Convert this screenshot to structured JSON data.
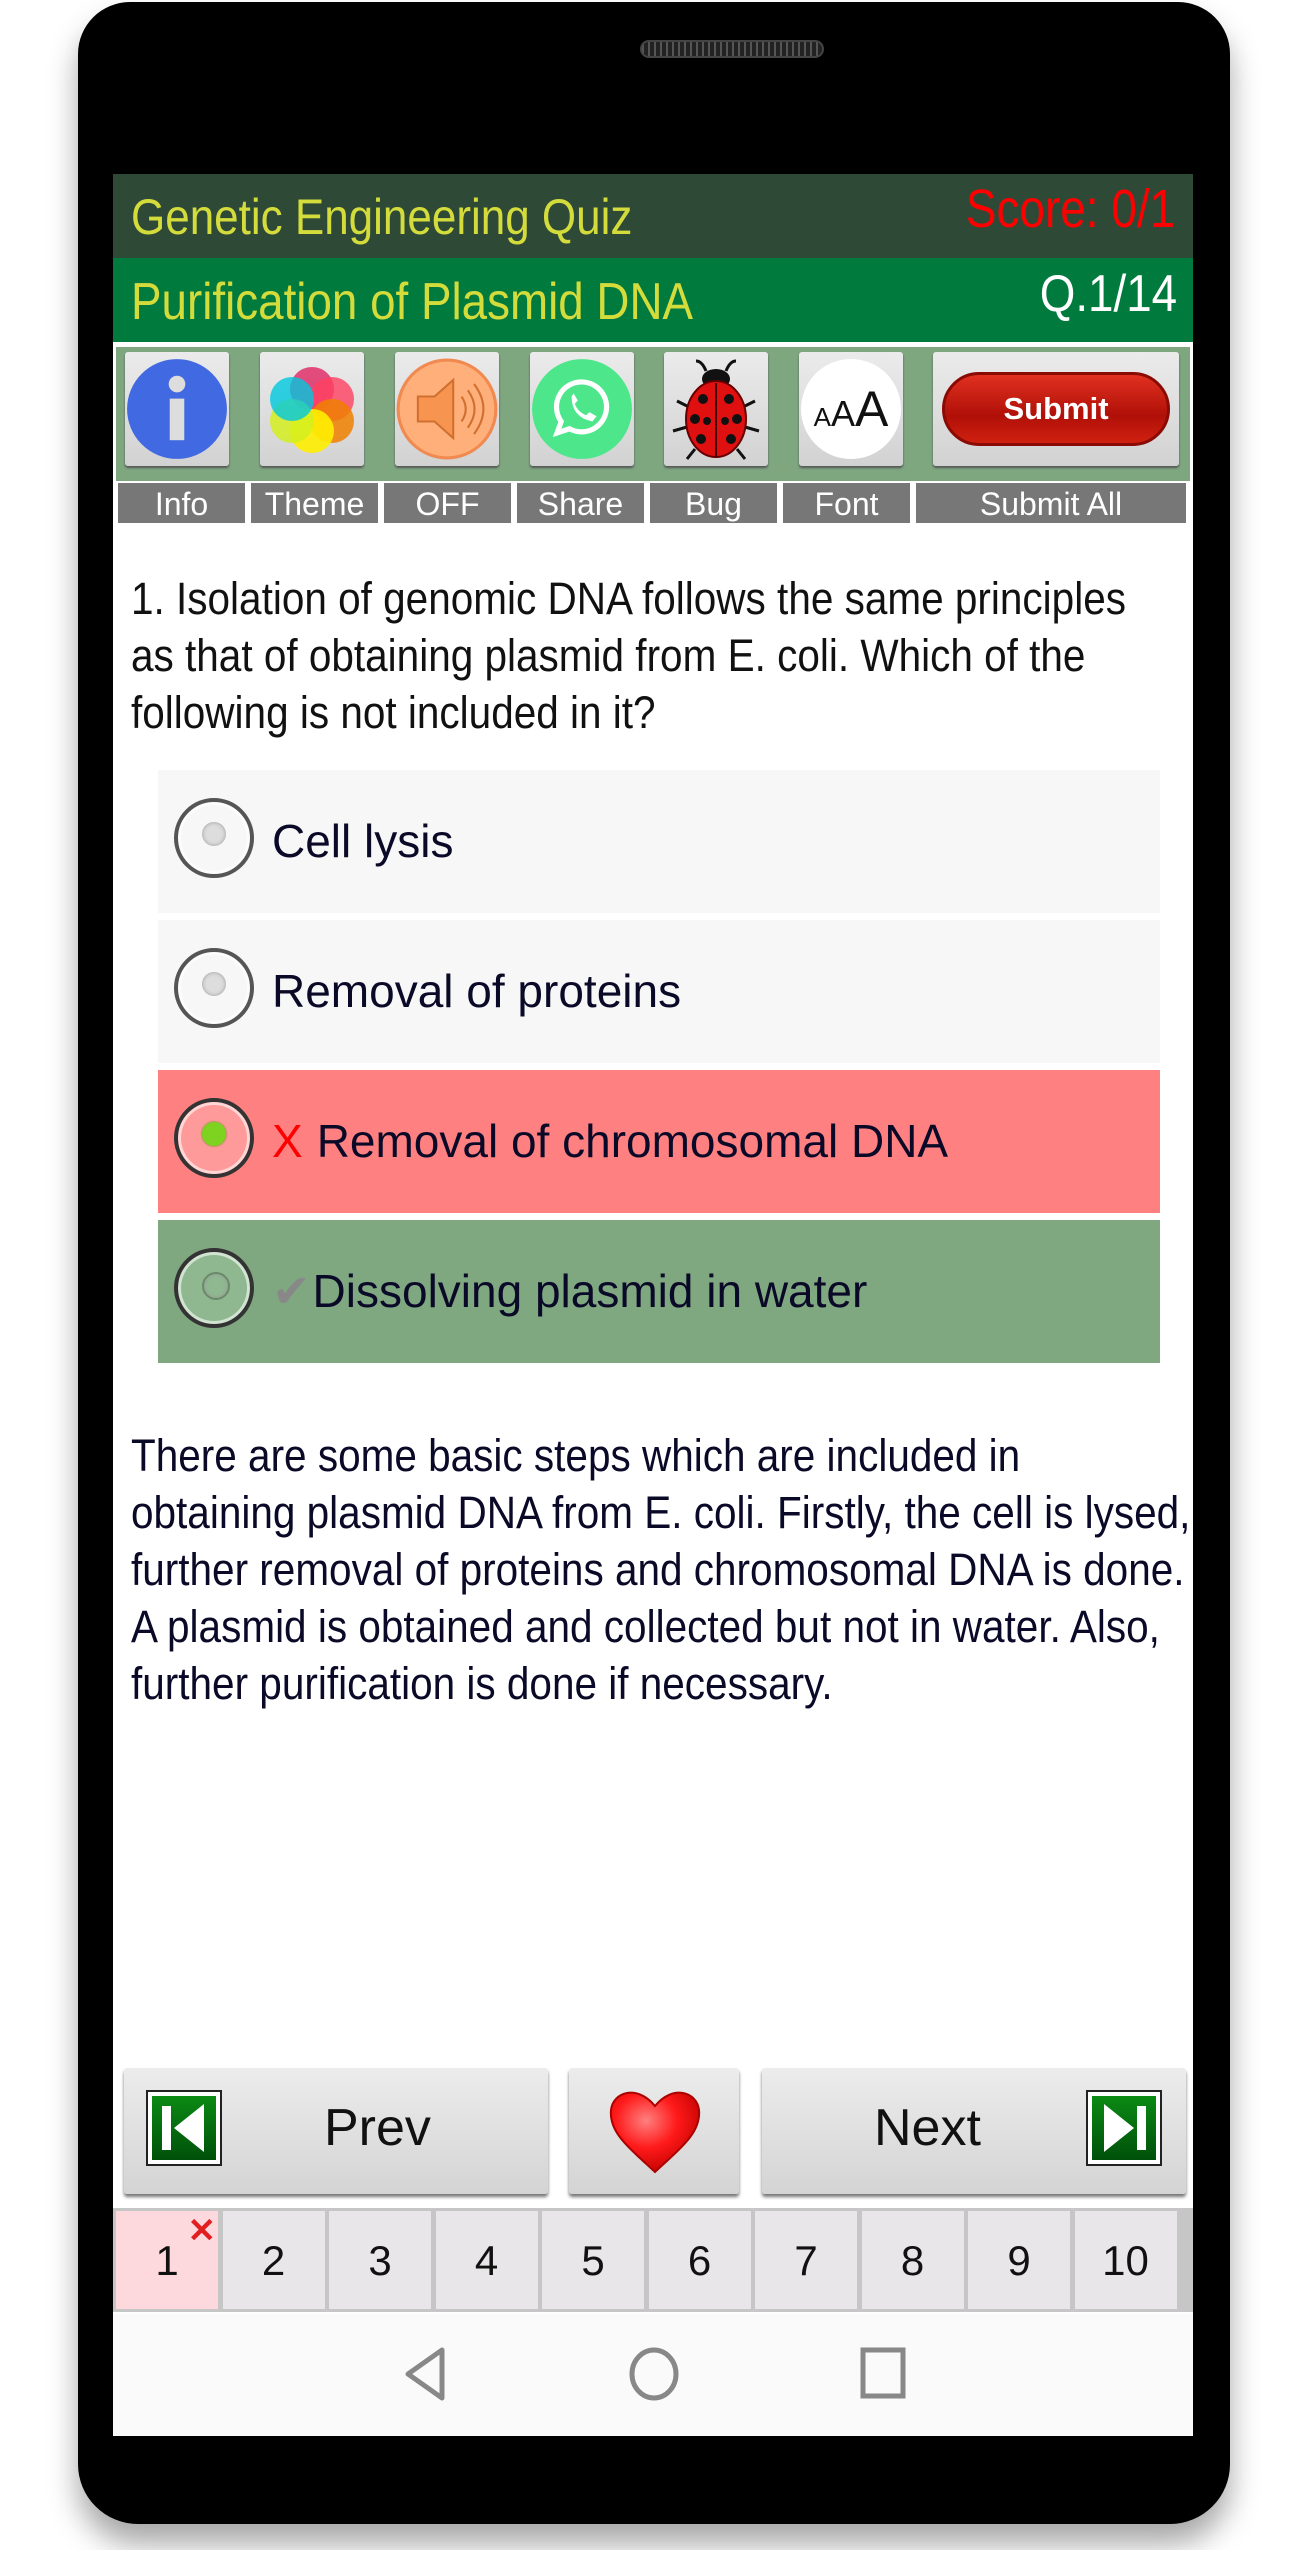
{
  "header": {
    "app_title": "Genetic Engineering Quiz",
    "score": "Score: 0/1",
    "topic": "Purification of Plasmid DNA",
    "question_counter": "Q.1/14"
  },
  "toolbar": {
    "buttons": [
      {
        "id": "info",
        "icon": "info-icon",
        "label": "Info"
      },
      {
        "id": "theme",
        "icon": "theme-petals-icon",
        "label": "Theme"
      },
      {
        "id": "sound",
        "icon": "speaker-icon",
        "label": "OFF"
      },
      {
        "id": "share",
        "icon": "whatsapp-icon",
        "label": "Share"
      },
      {
        "id": "bug",
        "icon": "ladybug-icon",
        "label": "Bug"
      },
      {
        "id": "font",
        "icon": "font-size-icon",
        "label": "Font"
      },
      {
        "id": "submit",
        "icon": "submit-pill",
        "label": "Submit All",
        "button_text": "Submit"
      }
    ],
    "font_glyphs": "AAA"
  },
  "question": {
    "text": "1. Isolation of genomic DNA follows the same principles as that of obtaining plasmid from E. coli. Which of the following is not included in it?",
    "options": [
      {
        "text": "Cell lysis",
        "state": "neutral",
        "selected": false,
        "mark": ""
      },
      {
        "text": "Removal of proteins",
        "state": "neutral",
        "selected": false,
        "mark": ""
      },
      {
        "text": "Removal of chromosomal DNA",
        "state": "wrong",
        "selected": true,
        "mark": "X"
      },
      {
        "text": "Dissolving plasmid in water",
        "state": "correct",
        "selected": false,
        "mark": "✔"
      }
    ],
    "explanation": "There are some basic steps which are included in obtaining plasmid DNA from E. coli. Firstly, the cell is lysed, further removal of proteins and chromosomal DNA is done. A plasmid is obtained and collected but not in water. Also, further purification is done if necessary."
  },
  "navigation": {
    "prev_label": "Prev",
    "next_label": "Next",
    "favorite_icon": "heart-icon"
  },
  "pages": [
    {
      "num": "1",
      "status": "wrong",
      "badge": "✕"
    },
    {
      "num": "2",
      "status": "unanswered",
      "badge": ""
    },
    {
      "num": "3",
      "status": "unanswered",
      "badge": ""
    },
    {
      "num": "4",
      "status": "unanswered",
      "badge": ""
    },
    {
      "num": "5",
      "status": "unanswered",
      "badge": ""
    },
    {
      "num": "6",
      "status": "unanswered",
      "badge": ""
    },
    {
      "num": "7",
      "status": "unanswered",
      "badge": ""
    },
    {
      "num": "8",
      "status": "unanswered",
      "badge": ""
    },
    {
      "num": "9",
      "status": "unanswered",
      "badge": ""
    },
    {
      "num": "10",
      "status": "unanswered",
      "badge": ""
    }
  ],
  "colors": {
    "header_dark": "#2e4a37",
    "header_green": "#007a3d",
    "title_yellow": "#d4dc3c",
    "score_red": "#ff0000",
    "wrong_bg": "#ff8080",
    "correct_bg": "#7fa780",
    "toolbar_bg": "#7ea780"
  }
}
